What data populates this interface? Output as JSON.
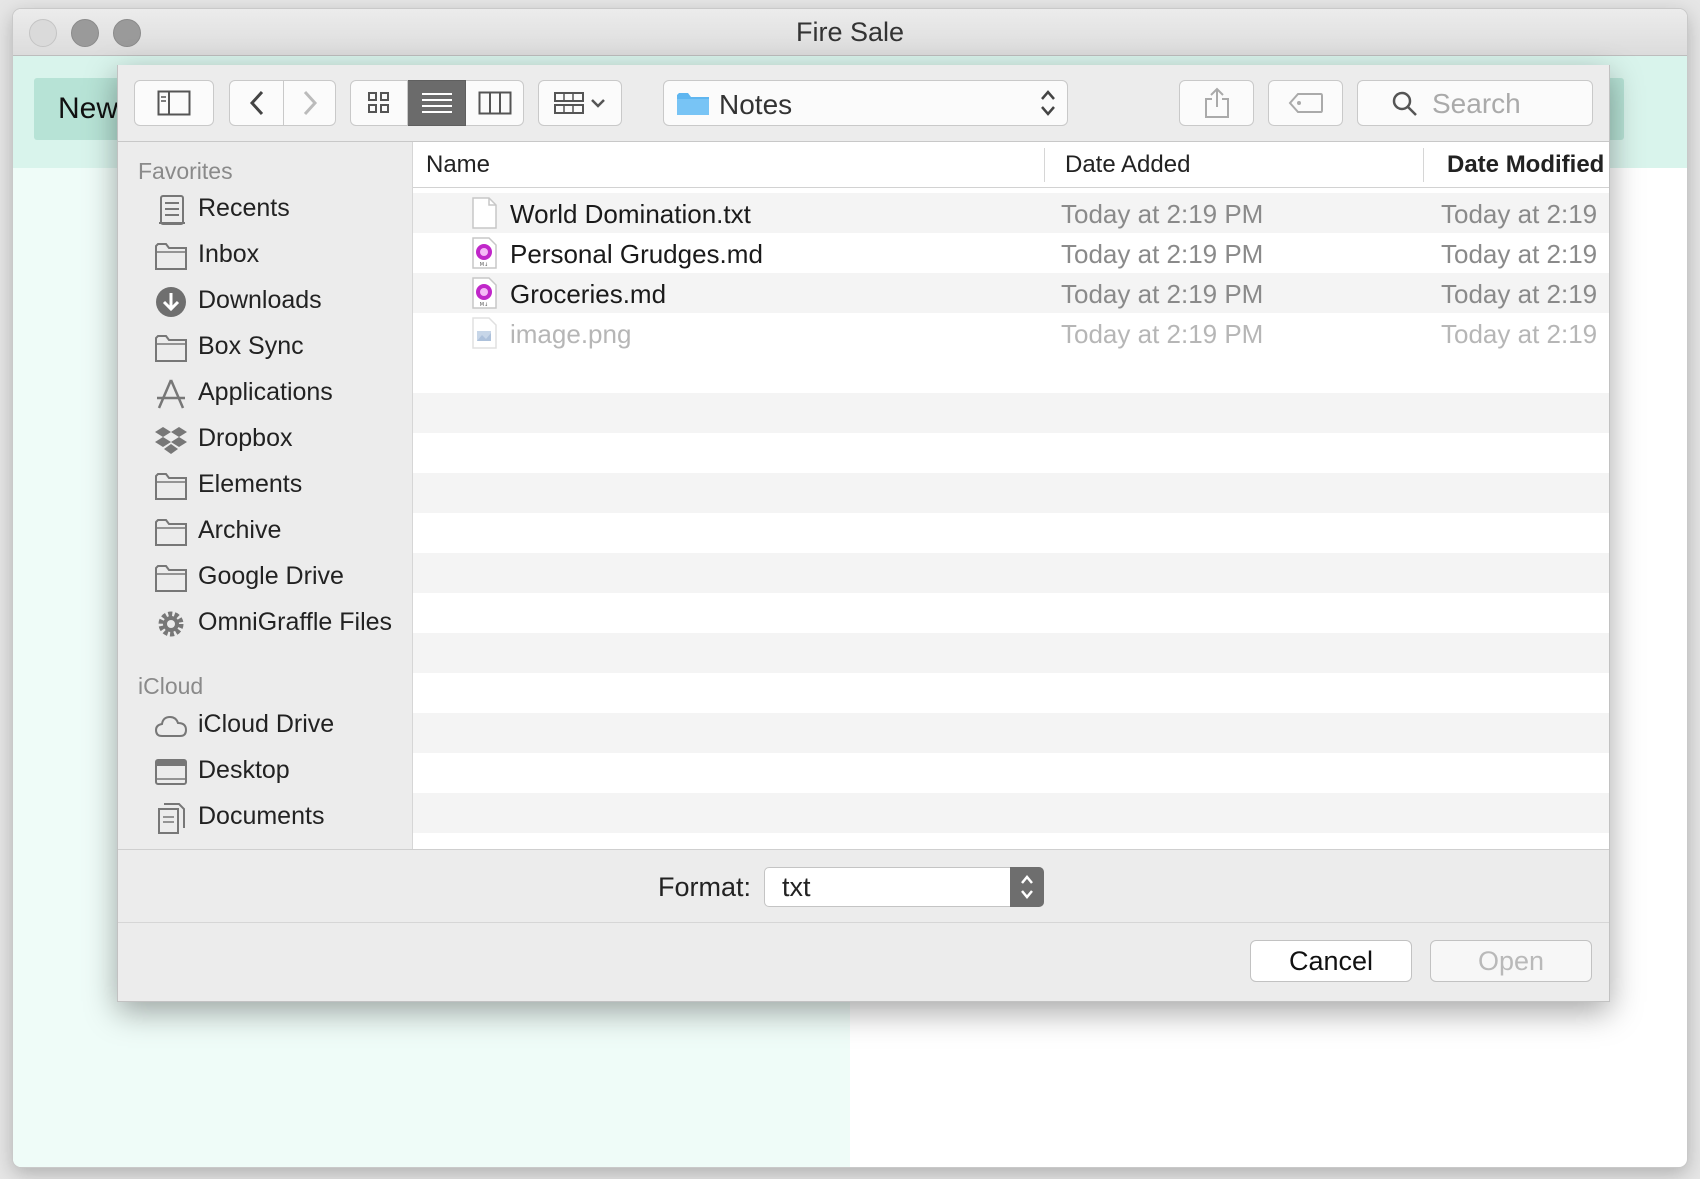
{
  "window": {
    "title": "Fire Sale"
  },
  "app": {
    "new_button_label": "New"
  },
  "toolbar": {
    "location": "Notes",
    "search_placeholder": "Search"
  },
  "sidebar": {
    "favorites_heading": "Favorites",
    "favorites": [
      {
        "label": "Recents",
        "icon": "recents-icon"
      },
      {
        "label": "Inbox",
        "icon": "folder-icon"
      },
      {
        "label": "Downloads",
        "icon": "downloads-icon"
      },
      {
        "label": "Box Sync",
        "icon": "folder-icon"
      },
      {
        "label": "Applications",
        "icon": "applications-icon"
      },
      {
        "label": "Dropbox",
        "icon": "dropbox-icon"
      },
      {
        "label": "Elements",
        "icon": "folder-icon"
      },
      {
        "label": "Archive",
        "icon": "folder-icon"
      },
      {
        "label": "Google Drive",
        "icon": "folder-icon"
      },
      {
        "label": "OmniGraffle Files",
        "icon": "gear-icon"
      }
    ],
    "icloud_heading": "iCloud",
    "icloud": [
      {
        "label": "iCloud Drive",
        "icon": "cloud-icon"
      },
      {
        "label": "Desktop",
        "icon": "desktop-icon"
      },
      {
        "label": "Documents",
        "icon": "documents-icon"
      }
    ]
  },
  "file_list": {
    "columns": [
      "Name",
      "Date Added",
      "Date Modified"
    ],
    "rows": [
      {
        "name": "World Domination.txt",
        "date_added": "Today at 2:19 PM",
        "date_modified": "Today at 2:19",
        "icon": "text-file-icon",
        "enabled": true
      },
      {
        "name": "Personal Grudges.md",
        "date_added": "Today at 2:19 PM",
        "date_modified": "Today at 2:19",
        "icon": "markdown-file-icon",
        "enabled": true
      },
      {
        "name": "Groceries.md",
        "date_added": "Today at 2:19 PM",
        "date_modified": "Today at 2:19",
        "icon": "markdown-file-icon",
        "enabled": true
      },
      {
        "name": "image.png",
        "date_added": "Today at 2:19 PM",
        "date_modified": "Today at 2:19",
        "icon": "image-file-icon",
        "enabled": false
      }
    ]
  },
  "format": {
    "label": "Format:",
    "value": "txt"
  },
  "buttons": {
    "cancel": "Cancel",
    "open": "Open"
  },
  "colors": {
    "app_background": "#effcf8",
    "header_band": "#d9f4ec",
    "new_button": "#b7e3d6",
    "active_segment": "#6b6b6b",
    "folder_blue": "#5fb6f0"
  }
}
